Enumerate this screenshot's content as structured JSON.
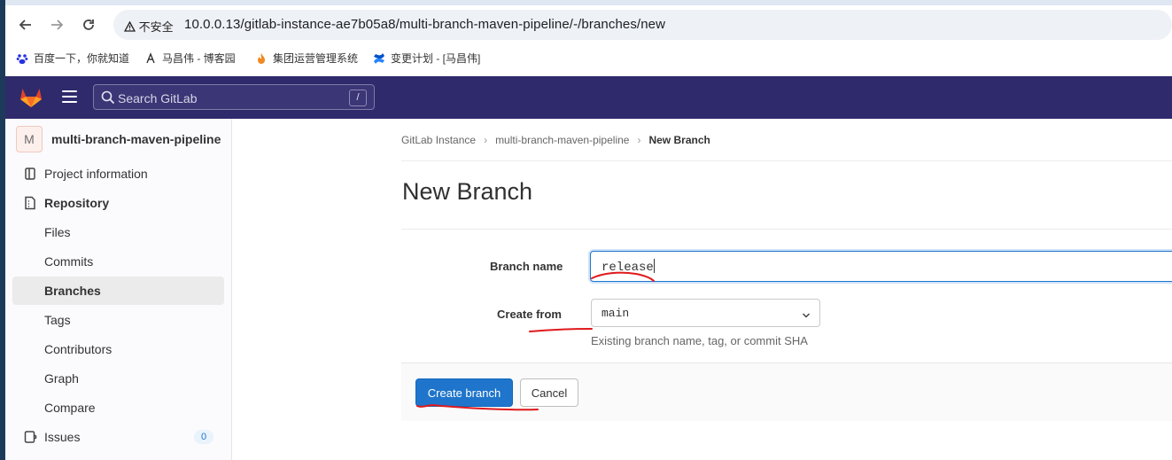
{
  "browser": {
    "insecure_label": "不安全",
    "url": "10.0.0.13/gitlab-instance-ae7b05a8/multi-branch-maven-pipeline/-/branches/new",
    "bookmarks": [
      {
        "label": "百度一下，你就知道",
        "icon": "baidu-icon"
      },
      {
        "label": "马昌伟 - 博客园",
        "icon": "cnblogs-icon"
      },
      {
        "label": "集团运营管理系统",
        "icon": "flame-icon"
      },
      {
        "label": "变更计划 - [马昌伟]",
        "icon": "confluence-icon"
      }
    ]
  },
  "header": {
    "search_placeholder": "Search GitLab",
    "search_shortcut": "/"
  },
  "sidebar": {
    "project_avatar": "M",
    "project_name": "multi-branch-maven-pipeline",
    "items": [
      {
        "label": "Project information",
        "icon": "project-info-icon"
      },
      {
        "label": "Repository",
        "icon": "repository-icon"
      },
      {
        "label": "Files"
      },
      {
        "label": "Commits"
      },
      {
        "label": "Branches",
        "active": true
      },
      {
        "label": "Tags"
      },
      {
        "label": "Contributors"
      },
      {
        "label": "Graph"
      },
      {
        "label": "Compare"
      },
      {
        "label": "Issues",
        "icon": "issues-icon",
        "badge": "0"
      }
    ]
  },
  "breadcrumb": [
    "GitLab Instance",
    "multi-branch-maven-pipeline",
    "New Branch"
  ],
  "page": {
    "title": "New Branch",
    "branch_name_label": "Branch name",
    "branch_name_value": "release",
    "create_from_label": "Create from",
    "create_from_value": "main",
    "create_from_help": "Existing branch name, tag, or commit SHA",
    "create_button": "Create branch",
    "cancel_button": "Cancel"
  },
  "colors": {
    "header_bg": "#2f2a6b",
    "primary": "#1f75cb",
    "annotation": "#e0191c"
  }
}
